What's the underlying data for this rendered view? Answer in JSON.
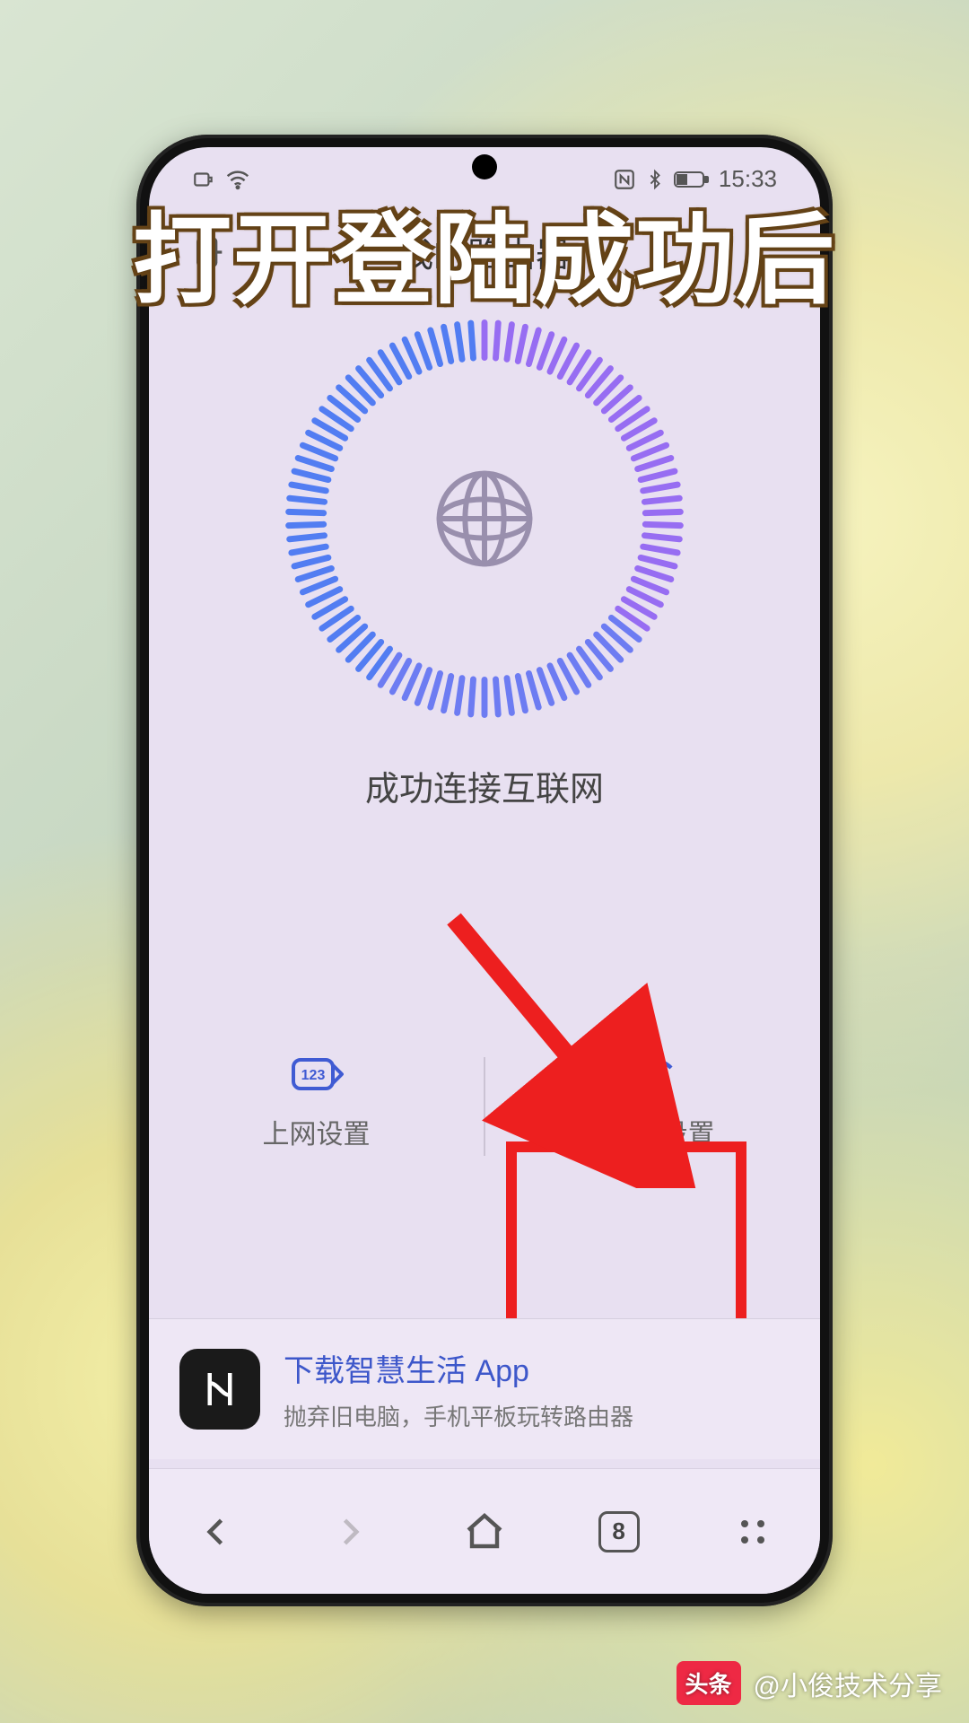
{
  "caption": "打开登陆成功后",
  "status": {
    "time": "15:33"
  },
  "header": {
    "title": "我的路由器"
  },
  "connection": {
    "status_text": "成功连接互联网"
  },
  "options": {
    "internet": {
      "label": "上网设置",
      "icon_text": "123"
    },
    "wifi": {
      "label": "Wi-Fi 设置"
    }
  },
  "promo": {
    "title": "下载智慧生活 App",
    "subtitle": "抛弃旧电脑，手机平板玩转路由器"
  },
  "browser": {
    "tab_count": "8"
  },
  "watermark": {
    "badge": "头条",
    "author": "@小俊技术分享"
  },
  "highlight_target": "wifi-settings-button"
}
